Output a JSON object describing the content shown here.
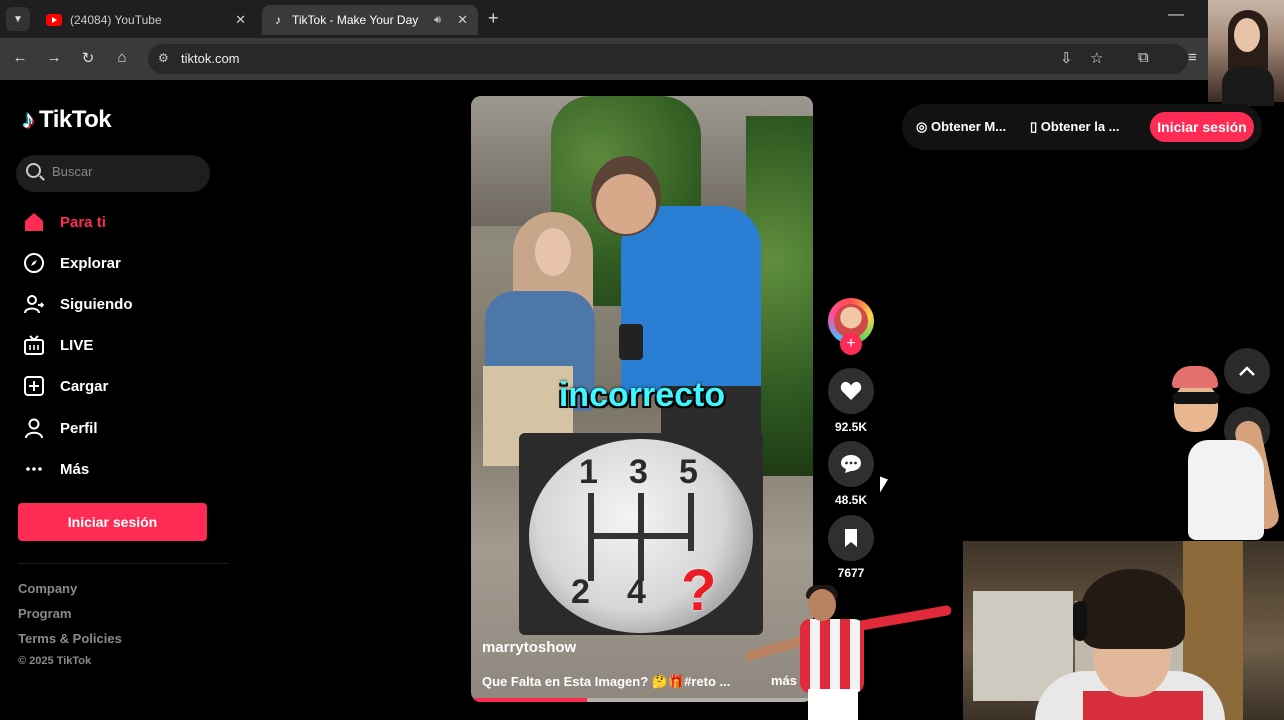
{
  "browser": {
    "tabs": [
      {
        "title": "(24084) YouTube",
        "favicon": "youtube-icon"
      },
      {
        "title": "TikTok - Make Your Day",
        "favicon": "tiktok-icon"
      }
    ],
    "url": "tiktok.com"
  },
  "sidebar": {
    "logo_text": "TikTok",
    "search_placeholder": "Buscar",
    "nav": [
      {
        "label": "Para ti",
        "icon": "home-icon",
        "active": true
      },
      {
        "label": "Explorar",
        "icon": "compass-icon"
      },
      {
        "label": "Siguiendo",
        "icon": "following-icon"
      },
      {
        "label": "LIVE",
        "icon": "live-tv-icon"
      },
      {
        "label": "Cargar",
        "icon": "upload-plus-icon"
      },
      {
        "label": "Perfil",
        "icon": "profile-icon"
      },
      {
        "label": "Más",
        "icon": "more-dots-icon"
      }
    ],
    "login_label": "Iniciar sesión",
    "footer": [
      "Company",
      "Program",
      "Terms & Policies"
    ],
    "copyright": "© 2025 TikTok"
  },
  "video": {
    "caption": "incorrecto",
    "gear_numbers": [
      "1",
      "3",
      "5",
      "2",
      "4"
    ],
    "gear_question": "?",
    "author": "marrytoshow",
    "description": "Que Falta en Esta Imagen? 🤔🎁#reto ...",
    "more_label": "más",
    "progress": 0.34
  },
  "actions": {
    "likes": "92.5K",
    "comments": "48.5K",
    "saves": "7677"
  },
  "top_right": {
    "get_app": "Obtener M...",
    "get_desktop": "Obtener la ...",
    "login_label": "Iniciar sesión"
  },
  "colors": {
    "accent": "#fe2c55",
    "caption": "#3ff7ff"
  }
}
